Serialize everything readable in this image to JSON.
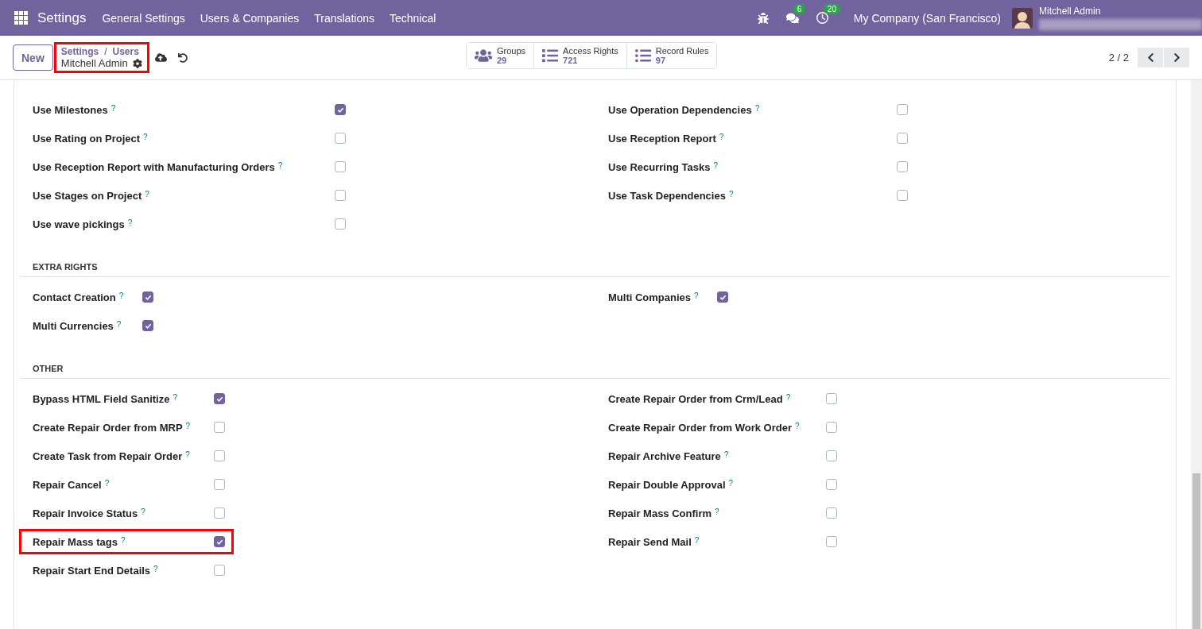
{
  "navbar": {
    "app_title": "Settings",
    "menu": [
      "General Settings",
      "Users & Companies",
      "Translations",
      "Technical"
    ],
    "messages_badge": "6",
    "activities_badge": "20",
    "company": "My Company (San Francisco)",
    "user_name": "Mitchell Admin"
  },
  "control_panel": {
    "new_button": "New",
    "breadcrumb": {
      "items": [
        "Settings",
        "Users"
      ],
      "separator": "/",
      "record": "Mitchell Admin",
      "highlighted": true
    },
    "stats": [
      {
        "kind": "groups",
        "label": "Groups",
        "value": "29"
      },
      {
        "kind": "list",
        "label": "Access Rights",
        "value": "721"
      },
      {
        "kind": "bullets",
        "label": "Record Rules",
        "value": "97"
      }
    ],
    "pager": "2 / 2"
  },
  "sections": [
    {
      "left": [
        {
          "label": "Use Milestones",
          "help": "?",
          "checked": true,
          "highlighted": false
        },
        {
          "label": "Use Rating on Project",
          "help": "?",
          "checked": false,
          "highlighted": false
        },
        {
          "label": "Use Reception Report with Manufacturing Orders",
          "help": "?",
          "checked": false,
          "highlighted": false
        },
        {
          "label": "Use Stages on Project",
          "help": "?",
          "checked": false,
          "highlighted": false
        },
        {
          "label": "Use wave pickings",
          "help": "?",
          "checked": false,
          "highlighted": false
        }
      ],
      "right": [
        {
          "label": "Use Operation Dependencies",
          "help": "?",
          "checked": false,
          "highlighted": false
        },
        {
          "label": "Use Reception Report",
          "help": "?",
          "checked": false,
          "highlighted": false
        },
        {
          "label": "Use Recurring Tasks",
          "help": "?",
          "checked": false,
          "highlighted": false
        },
        {
          "label": "Use Task Dependencies",
          "help": "?",
          "checked": false,
          "highlighted": false
        }
      ]
    },
    {
      "title": "EXTRA RIGHTS",
      "left": [
        {
          "label": "Contact Creation",
          "help": "?",
          "checked": true,
          "highlighted": false
        },
        {
          "label": "Multi Currencies",
          "help": "?",
          "checked": true,
          "highlighted": false
        }
      ],
      "right": [
        {
          "label": "Multi Companies",
          "help": "?",
          "checked": true,
          "highlighted": false
        }
      ]
    },
    {
      "title": "OTHER",
      "left": [
        {
          "label": "Bypass HTML Field Sanitize",
          "help": "?",
          "checked": true,
          "highlighted": false
        },
        {
          "label": "Create Repair Order from MRP",
          "help": "?",
          "checked": false,
          "highlighted": false
        },
        {
          "label": "Create Task from Repair Order",
          "help": "?",
          "checked": false,
          "highlighted": false
        },
        {
          "label": "Repair Cancel",
          "help": "?",
          "checked": false,
          "highlighted": false
        },
        {
          "label": "Repair Invoice Status",
          "help": "?",
          "checked": false,
          "highlighted": false
        },
        {
          "label": "Repair Mass tags",
          "help": "?",
          "checked": true,
          "highlighted": true
        },
        {
          "label": "Repair Start End Details",
          "help": "?",
          "checked": false,
          "highlighted": false
        }
      ],
      "right": [
        {
          "label": "Create Repair Order from Crm/Lead",
          "help": "?",
          "checked": false,
          "highlighted": false
        },
        {
          "label": "Create Repair Order from Work Order",
          "help": "?",
          "checked": false,
          "highlighted": false
        },
        {
          "label": "Repair Archive Feature",
          "help": "?",
          "checked": false,
          "highlighted": false
        },
        {
          "label": "Repair Double Approval",
          "help": "?",
          "checked": false,
          "highlighted": false
        },
        {
          "label": "Repair Mass Confirm",
          "help": "?",
          "checked": false,
          "highlighted": false
        },
        {
          "label": "Repair Send Mail",
          "help": "?",
          "checked": false,
          "highlighted": false
        }
      ]
    }
  ]
}
